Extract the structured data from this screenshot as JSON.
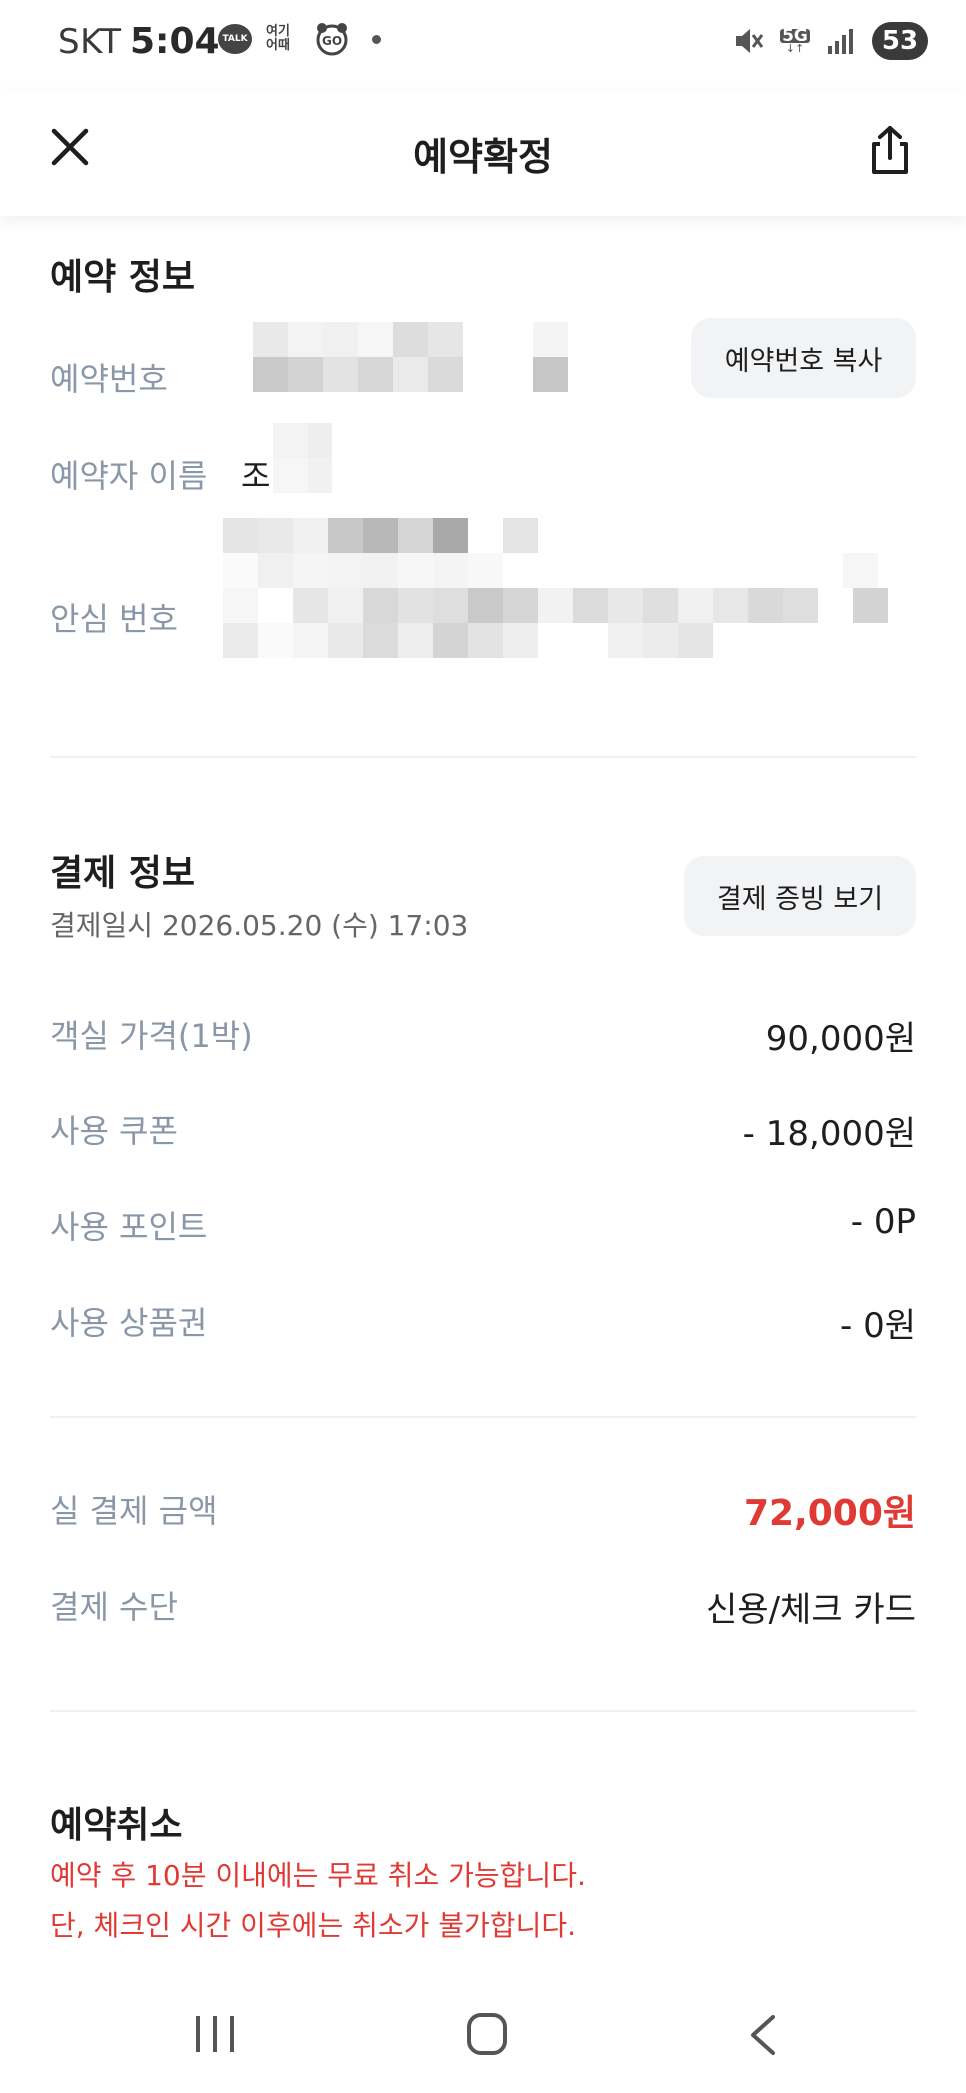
{
  "status_bar": {
    "carrier": "SKT",
    "time": "5:04",
    "talk_badge": "TALK",
    "notification_text": "여기 어때",
    "network": "5G",
    "battery": "53"
  },
  "header": {
    "title": "예약확정"
  },
  "reservation": {
    "title": "예약 정보",
    "number_label": "예약번호",
    "copy_button": "예약번호 복사",
    "name_label": "예약자 이름",
    "name_value": "조",
    "safe_number_label": "안심 번호"
  },
  "payment": {
    "title": "결제 정보",
    "date": "결제일시 2026.05.20 (수) 17:03",
    "receipt_button": "결제 증빙 보기",
    "items": [
      {
        "label": "객실 가격(1박)",
        "value": "90,000원"
      },
      {
        "label": "사용 쿠폰",
        "value": "- 18,000원"
      },
      {
        "label": "사용 포인트",
        "value": "- 0P"
      },
      {
        "label": "사용 상품권",
        "value": "- 0원"
      }
    ],
    "total_label": "실 결제 금액",
    "total_value": "72,000원",
    "method_label": "결제 수단",
    "method_value": "신용/체크 카드"
  },
  "cancel": {
    "title": "예약취소",
    "note_line1": "예약 후 10분 이내에는 무료 취소 가능합니다.",
    "note_line2": "단, 체크인 시간 이후에는 취소가 불가합니다."
  },
  "colors": {
    "label": "#8a97a8",
    "accent_red": "#e03a34",
    "button_bg": "#f2f3f5"
  }
}
